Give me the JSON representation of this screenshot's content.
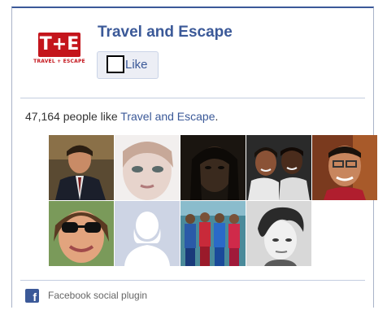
{
  "page": {
    "name": "Travel and Escape",
    "logo_text": "T+E",
    "logo_sub": "TRAVEL + ESCAPE"
  },
  "like_button": {
    "label": "Like"
  },
  "social": {
    "count": "47,164",
    "count_suffix": " people like ",
    "page_link": "Travel and Escape",
    "period": "."
  },
  "faces": [
    {
      "name": "friend-1",
      "icon": "person-photo"
    },
    {
      "name": "friend-2",
      "icon": "person-photo"
    },
    {
      "name": "friend-3",
      "icon": "person-photo"
    },
    {
      "name": "friend-4",
      "icon": "person-photo"
    },
    {
      "name": "friend-5",
      "icon": "person-photo"
    },
    {
      "name": "friend-6",
      "icon": "person-photo"
    },
    {
      "name": "friend-7",
      "icon": "default-silhouette"
    },
    {
      "name": "friend-8",
      "icon": "group-photo"
    },
    {
      "name": "friend-9",
      "icon": "person-photo"
    }
  ],
  "footer": {
    "icon": "facebook-icon",
    "text": "Facebook social plugin"
  },
  "colors": {
    "brand_blue": "#3b5998",
    "logo_red": "#c4151c",
    "button_bg": "#eceef5"
  }
}
